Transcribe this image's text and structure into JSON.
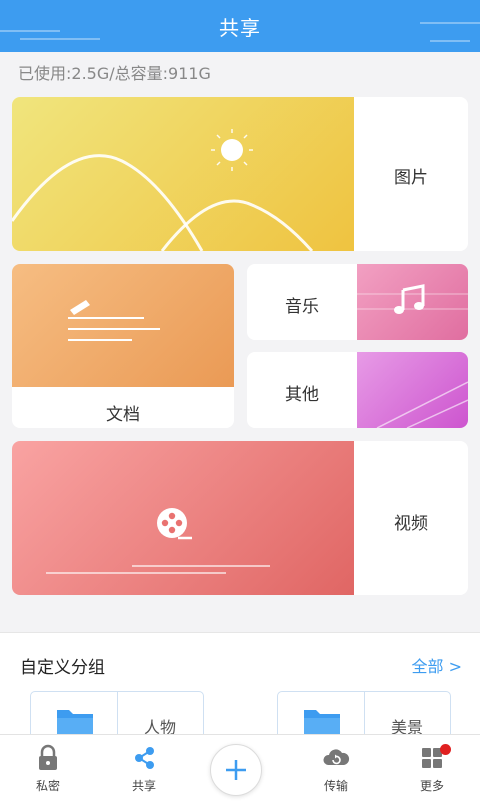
{
  "header": {
    "title": "共享"
  },
  "usage": {
    "text": "已使用:2.5G/总容量:911G"
  },
  "categories": {
    "pictures": "图片",
    "docs": "文档",
    "music": "音乐",
    "other": "其他",
    "video": "视频"
  },
  "custom_groups": {
    "title": "自定义分组",
    "all_label": "全部 >",
    "items": [
      {
        "label": "人物"
      },
      {
        "label": "美景"
      }
    ]
  },
  "tabbar": {
    "items": [
      {
        "label": "私密",
        "icon": "lock-icon"
      },
      {
        "label": "共享",
        "icon": "share-icon"
      },
      {
        "label": "",
        "icon": "plus-icon"
      },
      {
        "label": "传输",
        "icon": "cloud-sync-icon"
      },
      {
        "label": "更多",
        "icon": "grid-more-icon"
      }
    ],
    "notification_dot": true
  },
  "colors": {
    "accent": "#3d9cf0",
    "pictures": "#f0c94b",
    "docs": "#f1a768",
    "music": "#e878a8",
    "other": "#d865d6",
    "video": "#ee7877",
    "badge": "#e02020"
  }
}
